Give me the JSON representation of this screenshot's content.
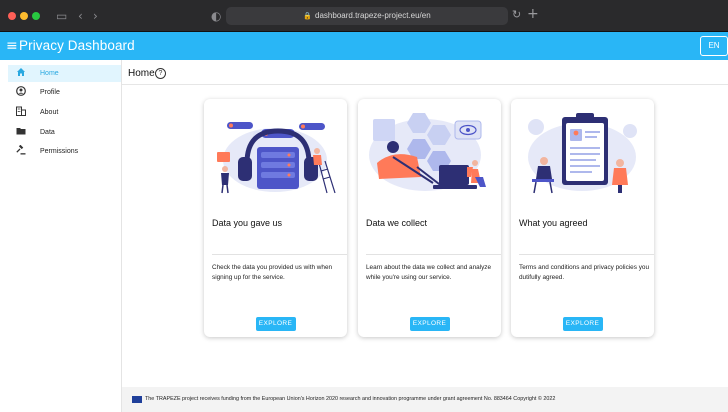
{
  "browser": {
    "url": "dashboard.trapeze-project.eu/en"
  },
  "app": {
    "title": "Privacy Dashboard",
    "language": "EN",
    "accent": "#29b6f6"
  },
  "sidebar": {
    "items": [
      {
        "label": "Home",
        "icon": "home-icon",
        "active": true
      },
      {
        "label": "Profile",
        "icon": "account-circle-icon"
      },
      {
        "label": "About",
        "icon": "business-icon"
      },
      {
        "label": "Data",
        "icon": "folder-icon"
      },
      {
        "label": "Permissions",
        "icon": "gavel-icon"
      }
    ]
  },
  "page": {
    "title": "Home",
    "help": "?"
  },
  "cards": [
    {
      "title": "Data you gave us",
      "description": "Check the data you provided us with when signing up for the service.",
      "button": "EXPLORE"
    },
    {
      "title": "Data we collect",
      "description": "Learn about the data we collect and analyze while you're using our service.",
      "button": "EXPLORE"
    },
    {
      "title": "What you agreed",
      "description": "Terms and conditions and privacy policies you dutifully agreed.",
      "button": "EXPLORE"
    }
  ],
  "footer": {
    "text": "The TRAPEZE project receives funding from the European Union's Horizon 2020 research and innovation programme under grant agreement No. 883464 Copyright © 2022"
  }
}
